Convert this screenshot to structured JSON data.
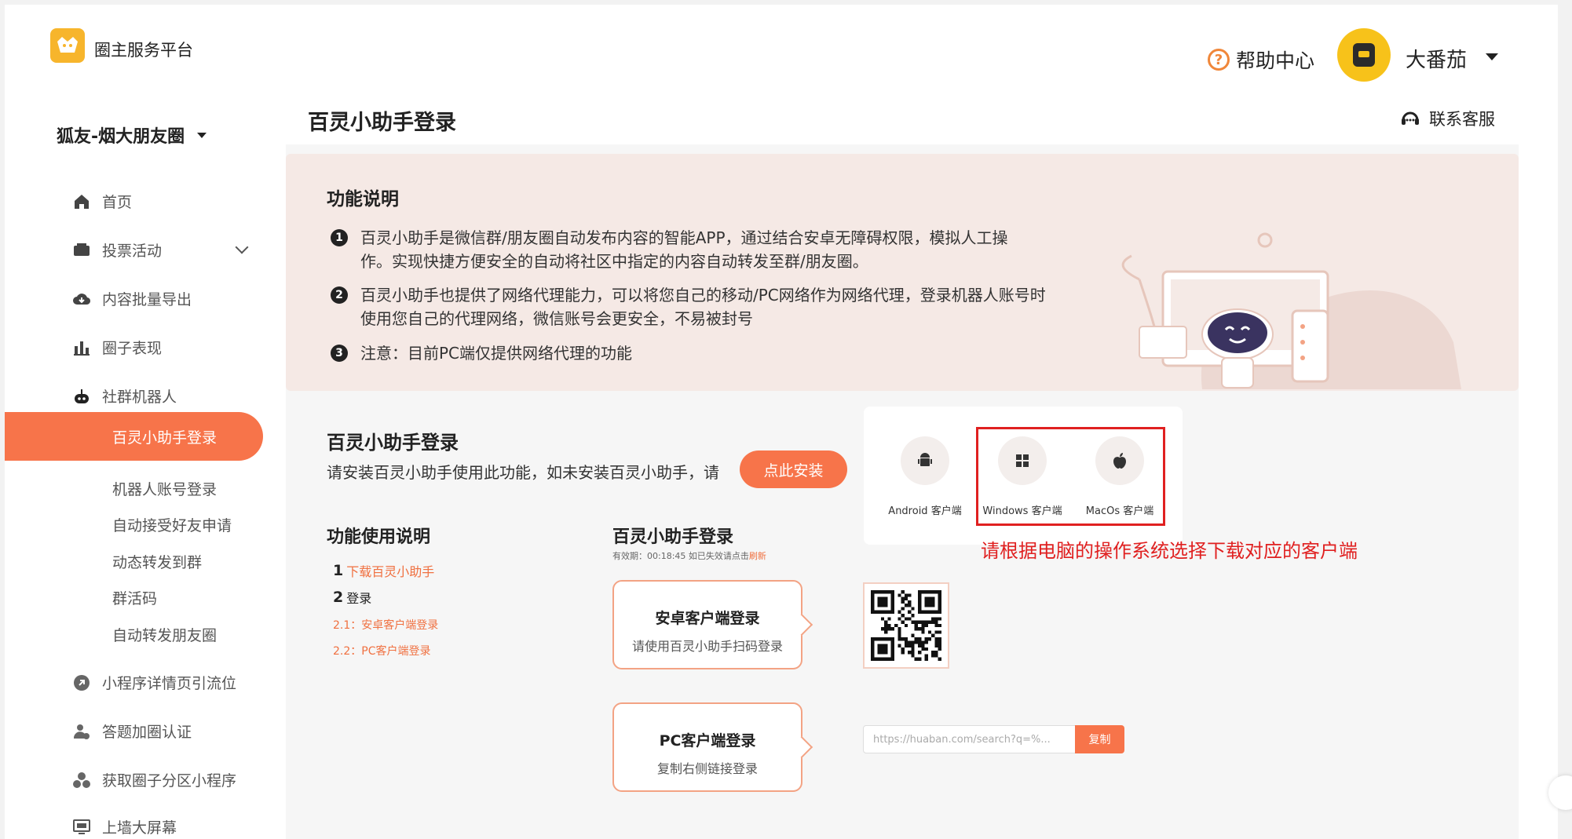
{
  "header": {
    "brand": "圈主服务平台",
    "help_label": "帮助中心",
    "user_name": "大番茄"
  },
  "sidebar": {
    "org_name": "狐友-烟大朋友圈",
    "items": [
      {
        "label": "首页",
        "icon": "home-icon"
      },
      {
        "label": "投票活动",
        "icon": "vote-icon"
      },
      {
        "label": "内容批量导出",
        "icon": "cloud-download-icon"
      },
      {
        "label": "圈子表现",
        "icon": "bar-chart-icon"
      },
      {
        "label": "社群机器人",
        "icon": "robot-icon"
      }
    ],
    "active_item": "百灵小助手登录",
    "sub_items": [
      "机器人账号登录",
      "自动接受好友申请",
      "动态转发到群",
      "群活码",
      "自动转发朋友圈"
    ],
    "more_items": [
      {
        "label": "小程序详情页引流位",
        "icon": "link-icon"
      },
      {
        "label": "答题加圈认证",
        "icon": "user-check-icon"
      },
      {
        "label": "获取圈子分区小程序",
        "icon": "cluster-icon"
      },
      {
        "label": "上墙大屏幕",
        "icon": "monitor-icon"
      }
    ]
  },
  "main": {
    "page_title": "百灵小助手登录",
    "contact_label": "联系客服",
    "function_title": "功能说明",
    "descriptions": [
      {
        "num": "1",
        "line1": "百灵小助手是微信群/朋友圈自动发布内容的智能APP，通过结合安卓无障碍权限，模拟人工操",
        "line2": "作。实现快捷方便安全的自动将社区中指定的内容自动转发至群/朋友圈。"
      },
      {
        "num": "2",
        "line1": "百灵小助手也提供了网络代理能力，可以将您自己的移动/PC网络作为网络代理，登录机器人账号时",
        "line2": "使用您自己的代理网络，微信账号会更安全，不易被封号"
      },
      {
        "num": "3",
        "line1": "注意：目前PC端仅提供网络代理的功能",
        "line2": ""
      }
    ],
    "login_title": "百灵小助手登录",
    "login_desc": "请安装百灵小助手使用此功能，如未安装百灵小助手，请",
    "install_button": "点此安装",
    "clients": [
      {
        "label": "Android 客户端",
        "icon": "android-icon"
      },
      {
        "label": "Windows 客户端",
        "icon": "windows-icon"
      },
      {
        "label": "MacOs 客户端",
        "icon": "apple-icon"
      }
    ],
    "annotation": "请根据电脑的操作系统选择下载对应的客户端",
    "usage_title": "功能使用说明",
    "steps": {
      "step1_num": "1",
      "step1_label": "下载百灵小助手",
      "step2_num": "2",
      "step2_label": "登录",
      "sub1": "2.1：安卓客户端登录",
      "sub2": "2.2：PC客户端登录"
    },
    "login_section_title": "百灵小助手登录",
    "validity_text": "有效期：00:18:45 如已失效请点击",
    "refresh_label": "刷新",
    "android_login": {
      "title": "安卓客户端登录",
      "desc": "请使用百灵小助手扫码登录"
    },
    "pc_login": {
      "title": "PC客户端登录",
      "desc": "复制右侧链接登录"
    },
    "url_value": "https://huaban.com/search?q=%...",
    "copy_button": "复制"
  },
  "colors": {
    "accent": "#f7744a",
    "banner_bg": "#f5e9e5",
    "annotation_red": "#e02020",
    "avatar_yellow": "#f7c21a"
  }
}
